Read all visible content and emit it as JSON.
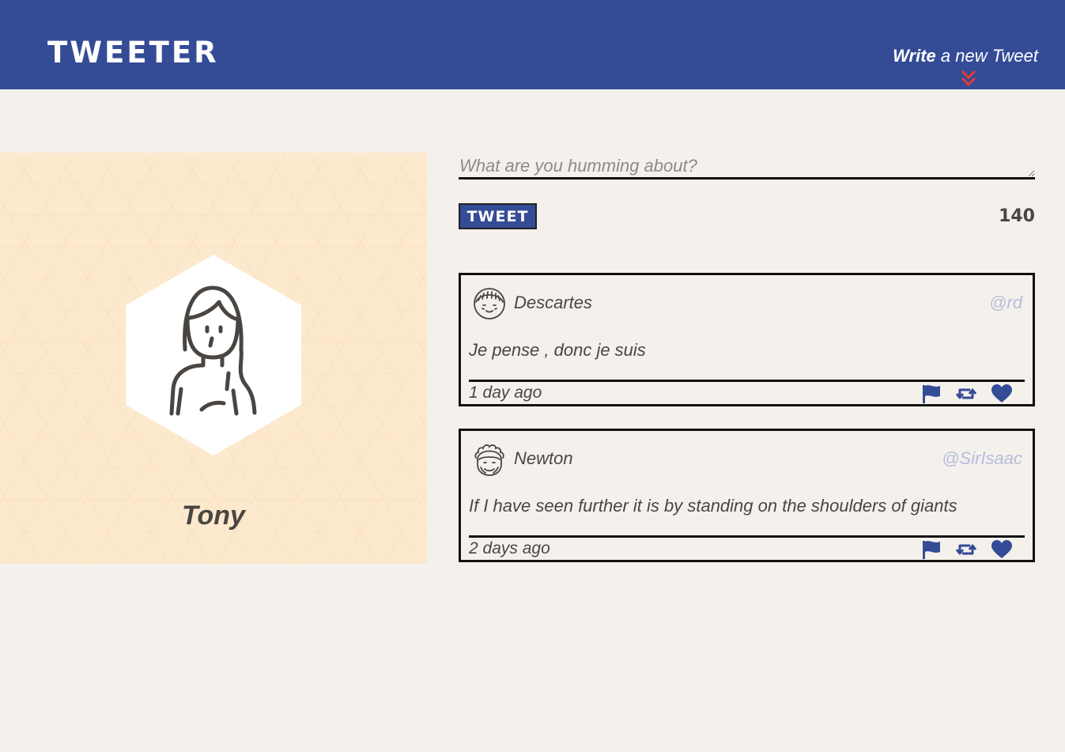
{
  "header": {
    "brand": "TWEETER",
    "compose_strong": "Write",
    "compose_rest": " a new Tweet",
    "chevron_icon": "double-chevron-down-icon",
    "bg_color": "#344b96",
    "accent_color": "#e53935"
  },
  "profile": {
    "name": "Tony",
    "avatar_icon": "person-long-hair-icon",
    "bg_color": "#fde9cd"
  },
  "composer": {
    "placeholder": "What are you humming about?",
    "value": "",
    "button_label": "Tweet",
    "counter": "140"
  },
  "tweets": [
    {
      "name": "Descartes",
      "handle": "@rd",
      "content": "Je pense , donc je suis",
      "time": "1 day ago",
      "avatar_icon": "face-bangs-icon",
      "actions": [
        "flag-icon",
        "retweet-icon",
        "heart-icon"
      ]
    },
    {
      "name": "Newton",
      "handle": "@SirIsaac",
      "content": "If I have seen further it is by standing on the shoulders of giants",
      "time": "2 days ago",
      "avatar_icon": "face-curly-hair-icon",
      "actions": [
        "flag-icon",
        "retweet-icon",
        "heart-icon"
      ]
    }
  ]
}
